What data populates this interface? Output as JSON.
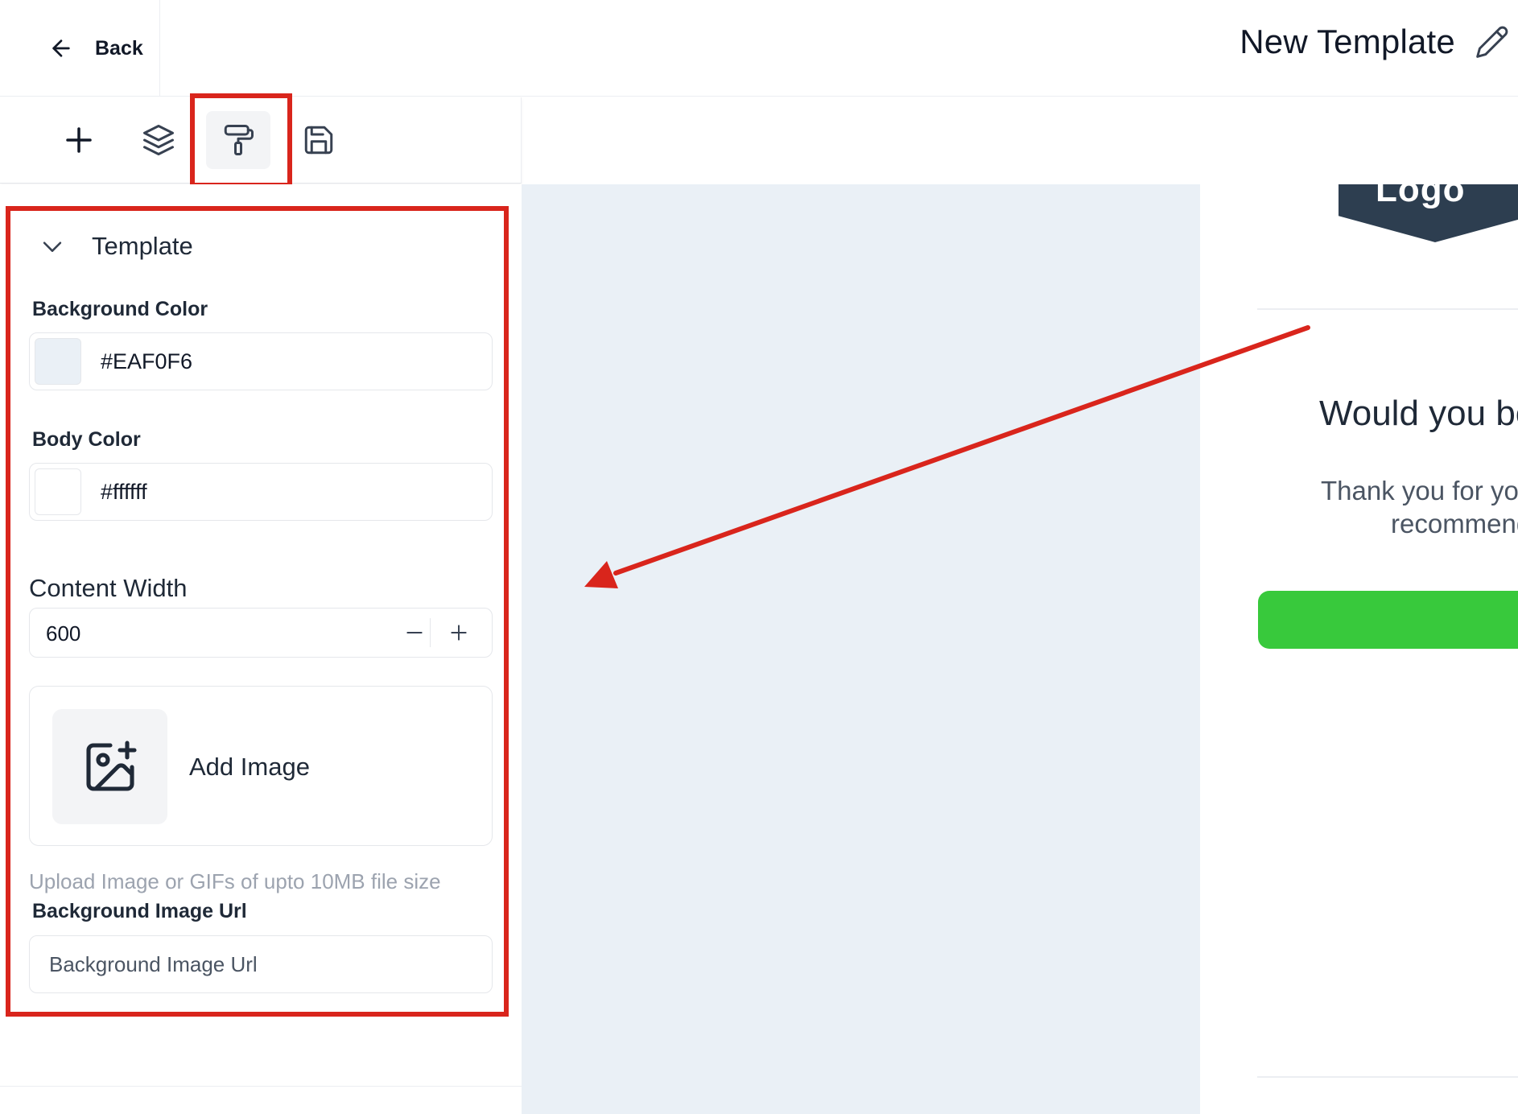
{
  "header": {
    "back_label": "Back",
    "title": "New Template"
  },
  "toolbar": {
    "tools": [
      {
        "icon": "plus-icon",
        "label": ""
      },
      {
        "icon": "layers-icon",
        "label": ""
      },
      {
        "icon": "paint-roller-icon",
        "label": "",
        "active": true
      },
      {
        "icon": "save-icon",
        "label": ""
      }
    ]
  },
  "panel": {
    "section_title": "Template",
    "background_color": {
      "label": "Background Color",
      "value": "#EAF0F6",
      "swatch": "#EAF0F6"
    },
    "body_color": {
      "label": "Body Color",
      "value": "#ffffff",
      "swatch": "#ffffff"
    },
    "content_width": {
      "label": "Content Width",
      "value": "600"
    },
    "add_image": {
      "label": "Add Image"
    },
    "helper_text": "Upload Image or GIFs of upto 10MB file size",
    "background_image_url": {
      "label": "Background Image Url",
      "placeholder": "Background Image Url",
      "value": ""
    }
  },
  "preview": {
    "logo_text": "Logo",
    "heading": "Would you be",
    "body_line1": "Thank you for you",
    "body_line2": "recommend",
    "cta_color": "#38C93C",
    "logo_color": "#2D3E50"
  },
  "colors": {
    "annotation_red": "#D9251C",
    "canvas_bg": "#EAF0F6"
  }
}
